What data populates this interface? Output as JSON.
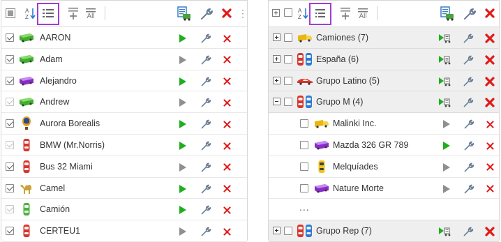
{
  "colors": {
    "accent_selected": "#a03ed2",
    "play_active": "#1fae1f",
    "play_inactive": "#8f8f8f",
    "delete": "#e01a1a",
    "group_row_bg": "#efefef"
  },
  "left_panel": {
    "toolbar": {
      "sort_az_icon": "sort-alpha-icon",
      "list_view_icon": "list-view-icon",
      "add_icon": "add-item-icon",
      "all_label": "All",
      "vehicle_report_icon": "vehicle-report-icon",
      "settings_icon": "wrench-icon",
      "delete_icon": "delete-icon",
      "menu_icon": "more-menu-icon"
    },
    "rows": [
      {
        "label": "AARON",
        "icon": "green-bus-icon",
        "checked": true,
        "faded": false,
        "play": "active"
      },
      {
        "label": "Adam",
        "icon": "green-bus-icon",
        "checked": true,
        "faded": false,
        "play": "inactive"
      },
      {
        "label": "Alejandro",
        "icon": "purple-bus-icon",
        "checked": true,
        "faded": false,
        "play": "active"
      },
      {
        "label": "Andrew",
        "icon": "green-bus-icon",
        "checked": true,
        "faded": true,
        "play": "inactive"
      },
      {
        "label": "Aurora Borealis",
        "icon": "balloon-icon",
        "checked": true,
        "faded": false,
        "play": "active"
      },
      {
        "label": "BMW (Mr.Norris)",
        "icon": "red-car-topview-icon",
        "checked": true,
        "faded": true,
        "play": "active"
      },
      {
        "label": "Bus 32 Miami",
        "icon": "red-car-topview-icon",
        "checked": true,
        "faded": false,
        "play": "inactive"
      },
      {
        "label": "Camel",
        "icon": "camel-icon",
        "checked": true,
        "faded": false,
        "play": "active"
      },
      {
        "label": "Camión",
        "icon": "green-car-topview-icon",
        "checked": true,
        "faded": true,
        "play": "active"
      },
      {
        "label": "CERTEU1",
        "icon": "red-car-topview-icon",
        "checked": true,
        "faded": false,
        "play": "inactive"
      }
    ]
  },
  "right_panel": {
    "toolbar": {
      "expand_all_icon": "expand-all-icon",
      "sort_az_icon": "sort-alpha-icon",
      "group_view_icon": "group-view-icon",
      "add_icon": "add-item-icon",
      "all_label": "All",
      "vehicle_report_icon": "vehicle-report-icon",
      "settings_icon": "wrench-icon",
      "delete_icon": "delete-icon"
    },
    "rows": [
      {
        "type": "group",
        "label": "Camiones (7)",
        "icon": "yellow-truck-icon",
        "expanded": false
      },
      {
        "type": "group",
        "label": "España (6)",
        "icon": "multi-car-icon",
        "expanded": false
      },
      {
        "type": "group",
        "label": "Grupo Latino (5)",
        "icon": "red-sportscar-icon",
        "expanded": false
      },
      {
        "type": "group",
        "label": "Grupo M (4)",
        "icon": "multi-car-icon",
        "expanded": true
      },
      {
        "type": "item",
        "label": "Malinki Inc.",
        "icon": "yellow-truck-icon",
        "play": "inactive"
      },
      {
        "type": "item",
        "label": "Mazda 326 GR 789",
        "icon": "purple-bus-icon",
        "play": "active"
      },
      {
        "type": "item",
        "label": "Melquíades",
        "icon": "yellow-car-topview-icon",
        "play": "inactive"
      },
      {
        "type": "item",
        "label": "Nature Morte",
        "icon": "purple-bus-icon",
        "play": "inactive"
      },
      {
        "type": "ellipsis",
        "label": "..."
      },
      {
        "type": "group",
        "label": "Grupo Rep (7)",
        "icon": "multi-car-icon",
        "expanded": false
      }
    ]
  }
}
